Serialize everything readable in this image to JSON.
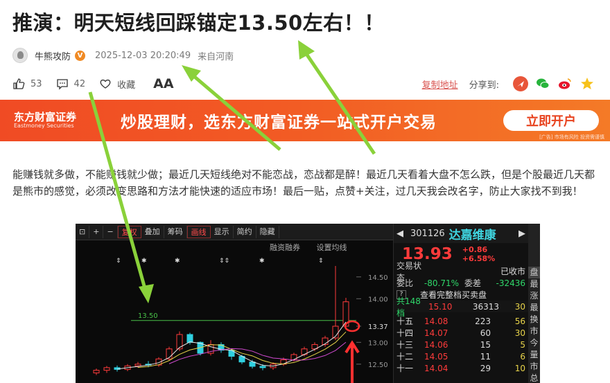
{
  "article": {
    "title": "推演：明天短线回踩锚定13.50左右！！",
    "author": "牛熊攻防",
    "verified_badge": "V",
    "date": "2025-12-03 20:20:49",
    "location": "来自河南"
  },
  "actions": {
    "likes": "53",
    "comments": "42",
    "favorite_label": "收藏",
    "font_size_label": "AA",
    "copy_link": "复制地址",
    "share_label": "分享到:"
  },
  "banner": {
    "logo_cn": "东方财富证券",
    "logo_en": "Eastmoney Securities",
    "slogan": "炒股理财，选东方财富证券一站式开户交易",
    "cta": "立即开户",
    "disclaimer": "[广告] 市场有风险 投资需谨慎"
  },
  "body": {
    "paragraph": "能赚钱就多做，不能赚钱就少做；最近几天短线绝对不能恋战，恋战都是醉！最近几天看着大盘不怎么跌，但是个股最近几天都是熊市的感觉，必须改变思路和方法才能快速的适应市场！最后一贴，点赞+关注，过几天我会改名字，防止大家找不到我！"
  },
  "chart_toolbar": {
    "items": [
      "复权",
      "叠加",
      "筹码",
      "画线",
      "显示",
      "简约",
      "隐藏"
    ],
    "sub_items": [
      "融资融券",
      "设置均线"
    ],
    "level_label": "13.50",
    "price_ticks": [
      "14.50",
      "14.00",
      "13.37",
      "13.00",
      "12.50"
    ]
  },
  "chart_data": {
    "type": "candlestick",
    "title": "",
    "reference_line": 13.5,
    "y_ticks": [
      14.5,
      14.0,
      13.37,
      13.0,
      12.5
    ],
    "series": [
      {
        "values": [
          {
            "o": 12.3,
            "c": 12.36,
            "h": 12.4,
            "l": 12.25
          },
          {
            "o": 12.36,
            "c": 12.42,
            "h": 12.46,
            "l": 12.3
          },
          {
            "o": 12.42,
            "c": 12.38,
            "h": 12.47,
            "l": 12.33
          },
          {
            "o": 12.38,
            "c": 12.46,
            "h": 12.5,
            "l": 12.34
          },
          {
            "o": 12.46,
            "c": 12.5,
            "h": 12.55,
            "l": 12.42
          },
          {
            "o": 12.5,
            "c": 12.48,
            "h": 12.57,
            "l": 12.43
          },
          {
            "o": 12.48,
            "c": 12.62,
            "h": 12.66,
            "l": 12.44
          },
          {
            "o": 12.62,
            "c": 12.85,
            "h": 12.9,
            "l": 12.58
          },
          {
            "o": 12.85,
            "c": 13.18,
            "h": 13.25,
            "l": 12.8
          },
          {
            "o": 13.18,
            "c": 13.0,
            "h": 13.22,
            "l": 12.95
          },
          {
            "o": 13.0,
            "c": 12.75,
            "h": 13.02,
            "l": 12.7
          },
          {
            "o": 12.75,
            "c": 12.95,
            "h": 13.05,
            "l": 12.7
          },
          {
            "o": 12.95,
            "c": 12.82,
            "h": 13.0,
            "l": 12.76
          },
          {
            "o": 12.82,
            "c": 12.68,
            "h": 12.86,
            "l": 12.6
          },
          {
            "o": 12.68,
            "c": 12.55,
            "h": 12.72,
            "l": 12.5
          },
          {
            "o": 12.55,
            "c": 12.45,
            "h": 12.6,
            "l": 12.4
          },
          {
            "o": 12.45,
            "c": 12.42,
            "h": 12.5,
            "l": 12.36
          },
          {
            "o": 12.42,
            "c": 12.5,
            "h": 12.54,
            "l": 12.37
          },
          {
            "o": 12.5,
            "c": 12.6,
            "h": 12.65,
            "l": 12.46
          },
          {
            "o": 12.6,
            "c": 12.72,
            "h": 12.76,
            "l": 12.56
          },
          {
            "o": 12.72,
            "c": 12.85,
            "h": 12.9,
            "l": 12.68
          },
          {
            "o": 12.85,
            "c": 12.95,
            "h": 13.0,
            "l": 12.8
          },
          {
            "o": 12.95,
            "c": 13.1,
            "h": 13.15,
            "l": 12.9
          },
          {
            "o": 13.1,
            "c": 13.37,
            "h": 14.75,
            "l": 13.05
          },
          {
            "o": 13.37,
            "c": 13.93,
            "h": 14.02,
            "l": 13.3
          }
        ]
      }
    ]
  },
  "quote": {
    "code": "301126",
    "name": "达嘉维康",
    "price": "13.93",
    "change": "+0.86",
    "change_pct": "+6.58%",
    "status_label": "交易状态",
    "status_value": "已收市",
    "ratio_label": "委比",
    "ratio_value": "-80.71%",
    "diff_label": "委差",
    "diff_value": "-32436",
    "full_book": "查看完整档买卖盘",
    "total_levels": "共148档",
    "total_price": "15.10",
    "total_vol": "36313",
    "total_cnt": "30",
    "asks": [
      {
        "level": "十五",
        "price": "14.08",
        "vol": "223",
        "cnt": "56"
      },
      {
        "level": "十四",
        "price": "14.07",
        "vol": "60",
        "cnt": "30"
      },
      {
        "level": "十三",
        "price": "14.06",
        "vol": "15",
        "cnt": "5"
      },
      {
        "level": "十二",
        "price": "14.05",
        "vol": "11",
        "cnt": "6"
      },
      {
        "level": "十一",
        "price": "14.04",
        "vol": "29",
        "cnt": "10"
      }
    ],
    "side_tabs": [
      "盘",
      "最",
      "涨",
      "最",
      "换",
      "市",
      "今",
      "量",
      "市",
      "总",
      "净"
    ]
  }
}
